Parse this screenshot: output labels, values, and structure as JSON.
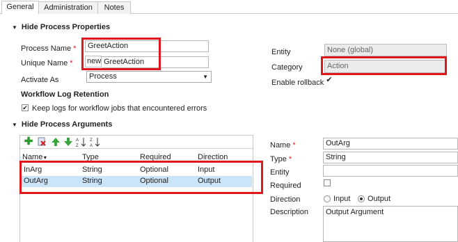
{
  "tabs": [
    {
      "label": "General"
    },
    {
      "label": "Administration"
    },
    {
      "label": "Notes"
    }
  ],
  "properties_section": {
    "title": "Hide Process Properties",
    "process_name_label": "Process Name",
    "process_name_value": "GreetAction",
    "unique_name_label": "Unique Name",
    "unique_name_prefix": "new_",
    "unique_name_value": "GreetAction",
    "activate_as_label": "Activate As",
    "activate_as_value": "Process",
    "entity_label": "Entity",
    "entity_value": "None (global)",
    "category_label": "Category",
    "category_value": "Action",
    "enable_rollback_label": "Enable rollback",
    "enable_rollback_checked": true,
    "log_retention_title": "Workflow Log Retention",
    "keep_logs_label": "Keep logs for workflow jobs that encountered errors",
    "keep_logs_checked": true
  },
  "arguments_section": {
    "title": "Hide Process Arguments",
    "toolbar_icons": [
      "add-icon",
      "delete-icon",
      "move-up-icon",
      "move-down-icon",
      "sort-ascending-icon",
      "sort-descending-icon"
    ],
    "columns": [
      "Name",
      "Type",
      "Required",
      "Direction"
    ],
    "rows": [
      {
        "name": "InArg",
        "type": "String",
        "required": "Optional",
        "direction": "Input"
      },
      {
        "name": "OutArg",
        "type": "String",
        "required": "Optional",
        "direction": "Output"
      }
    ],
    "selected_row": 1
  },
  "details": {
    "name_label": "Name",
    "name_value": "OutArg",
    "type_label": "Type",
    "type_value": "String",
    "entity_label": "Entity",
    "entity_value": "",
    "required_label": "Required",
    "required_checked": false,
    "direction_label": "Direction",
    "direction_input": "Input",
    "direction_output": "Output",
    "direction_selected": "Output",
    "description_label": "Description",
    "description_value": "Output Argument"
  },
  "colors": {
    "highlight_border": "#e0161c",
    "selected_row_bg": "#cce4f7",
    "required_asterisk": "#e01b1b"
  }
}
